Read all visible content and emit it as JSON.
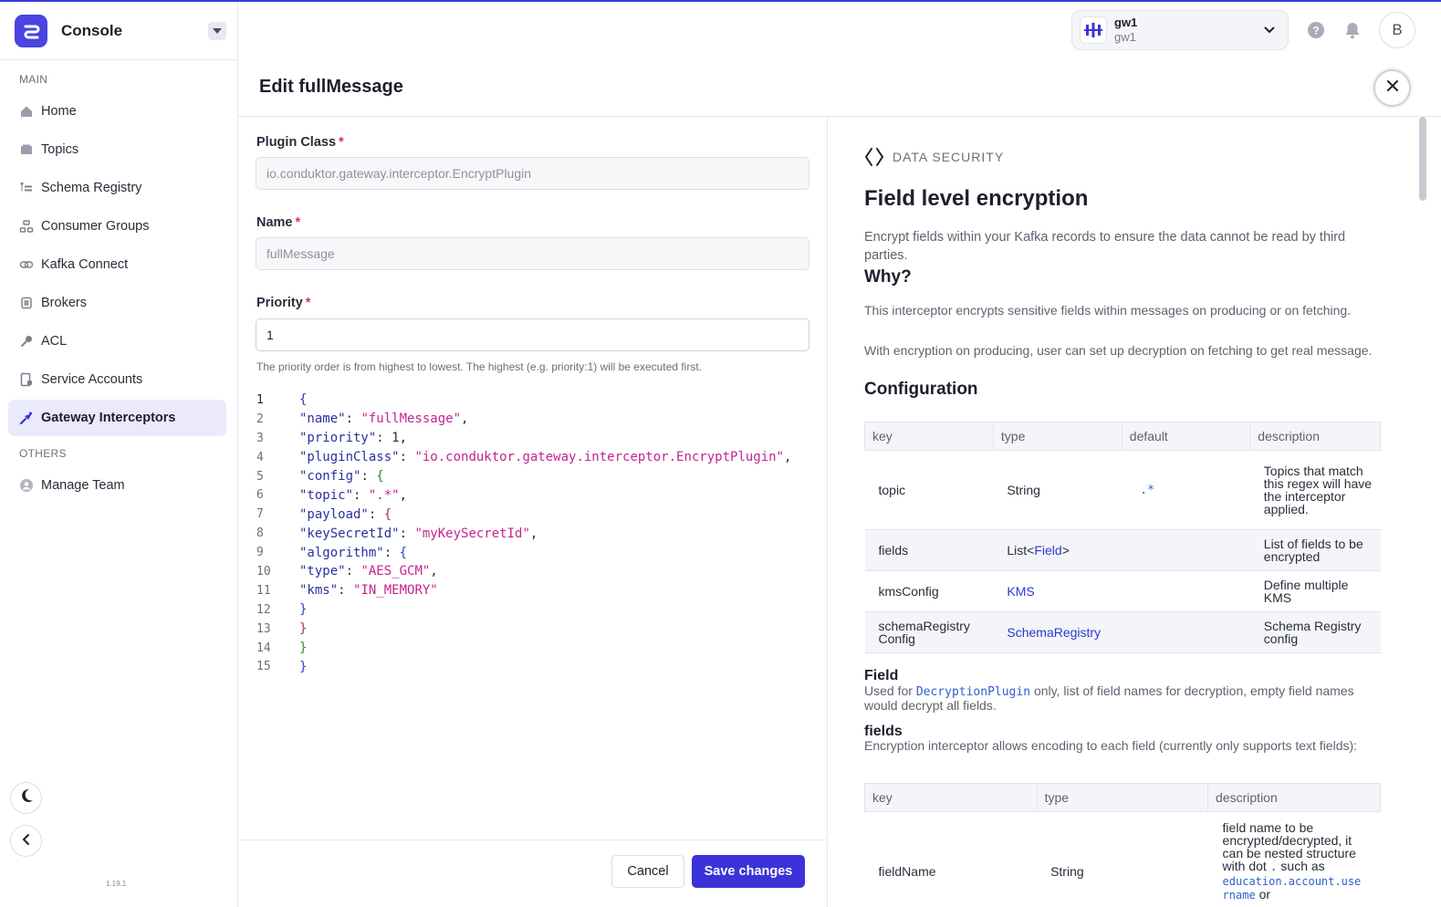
{
  "app": {
    "name": "Console",
    "version": "1.19.1"
  },
  "sidebar": {
    "main_label": "MAIN",
    "items": [
      {
        "label": "Home",
        "icon": "home-icon"
      },
      {
        "label": "Topics",
        "icon": "topics-icon"
      },
      {
        "label": "Schema Registry",
        "icon": "schema-icon"
      },
      {
        "label": "Consumer Groups",
        "icon": "consumer-groups-icon"
      },
      {
        "label": "Kafka Connect",
        "icon": "kafka-connect-icon"
      },
      {
        "label": "Brokers",
        "icon": "brokers-icon"
      },
      {
        "label": "ACL",
        "icon": "key-icon"
      },
      {
        "label": "Service Accounts",
        "icon": "service-accounts-icon"
      },
      {
        "label": "Gateway Interceptors",
        "icon": "interceptor-icon",
        "active": true
      }
    ],
    "others_label": "OTHERS",
    "others": [
      {
        "label": "Manage Team",
        "icon": "user-icon"
      }
    ]
  },
  "header": {
    "gateway": {
      "name": "gw1",
      "sub": "gw1"
    },
    "avatar_initial": "B"
  },
  "panel": {
    "title": "Edit fullMessage",
    "plugin_class": {
      "label": "Plugin Class",
      "value": "io.conduktor.gateway.interceptor.EncryptPlugin"
    },
    "name": {
      "label": "Name",
      "value": "fullMessage"
    },
    "priority": {
      "label": "Priority",
      "value": "1",
      "helper": "The priority order is from highest to lowest. The highest (e.g. priority:1) will be executed first."
    },
    "required_mark": "*",
    "code_lines": [
      "1",
      "2",
      "3",
      "4",
      "5",
      "6",
      "7",
      "8",
      "9",
      "10",
      "11",
      "12",
      "13",
      "14",
      "15"
    ],
    "code": {
      "l2k": "\"name\"",
      "l2v": "\"fullMessage\"",
      "l3k": "\"priority\"",
      "l3v": "1",
      "l4k": "\"pluginClass\"",
      "l4v": "\"io.conduktor.gateway.interceptor.EncryptPlugin\"",
      "l5k": "\"config\"",
      "l6k": "\"topic\"",
      "l6v": "\".*\"",
      "l7k": "\"payload\"",
      "l8k": "\"keySecretId\"",
      "l8v": "\"myKeySecretId\"",
      "l9k": "\"algorithm\"",
      "l10k": "\"type\"",
      "l10v": "\"AES_GCM\"",
      "l11k": "\"kms\"",
      "l11v": "\"IN_MEMORY\""
    },
    "cancel_label": "Cancel",
    "save_label": "Save changes"
  },
  "docs": {
    "eyebrow": "DATA SECURITY",
    "title": "Field level encryption",
    "intro": "Encrypt fields within your Kafka records to ensure the data cannot be read by third parties.",
    "why_title": "Why?",
    "why_p1": "This interceptor encrypts sensitive fields within messages on producing or on fetching.",
    "why_p2": "With encryption on producing, user can set up decryption on fetching to get real message.",
    "config_title": "Configuration",
    "config_headers": [
      "key",
      "type",
      "default",
      "description"
    ],
    "config_rows": [
      {
        "key": "topic",
        "type": "String",
        "default": ".*",
        "description": "Topics that match this regex will have the interceptor applied."
      },
      {
        "key": "fields",
        "type_pre": "List<",
        "type_link": "Field",
        "type_post": ">",
        "default": "",
        "description": "List of fields to be encrypted"
      },
      {
        "key": "kmsConfig",
        "type_link": "KMS",
        "default": "",
        "description": "Define multiple KMS"
      },
      {
        "key": "schemaRegistry Config",
        "type_link": "SchemaRegistry",
        "default": "",
        "description": "Schema Registry config"
      }
    ],
    "field_title": "Field",
    "field_pre": "Used for",
    "field_code": "DecryptionPlugin",
    "field_post": "only, list of field names for decryption, empty field names would decrypt all fields.",
    "fields_title": "fields",
    "fields_desc": "Encryption interceptor allows encoding to each field (currently only supports text fields):",
    "fields_headers": [
      "key",
      "type",
      "description"
    ],
    "fields_row": {
      "key": "fieldName",
      "type": "String",
      "desc_pre": "field name to be encrypted/decrypted, it can be nested structure with dot",
      "desc_code1": ".",
      "desc_mid": "such as",
      "desc_code2": "education.account.use rname",
      "desc_post": "or"
    }
  }
}
